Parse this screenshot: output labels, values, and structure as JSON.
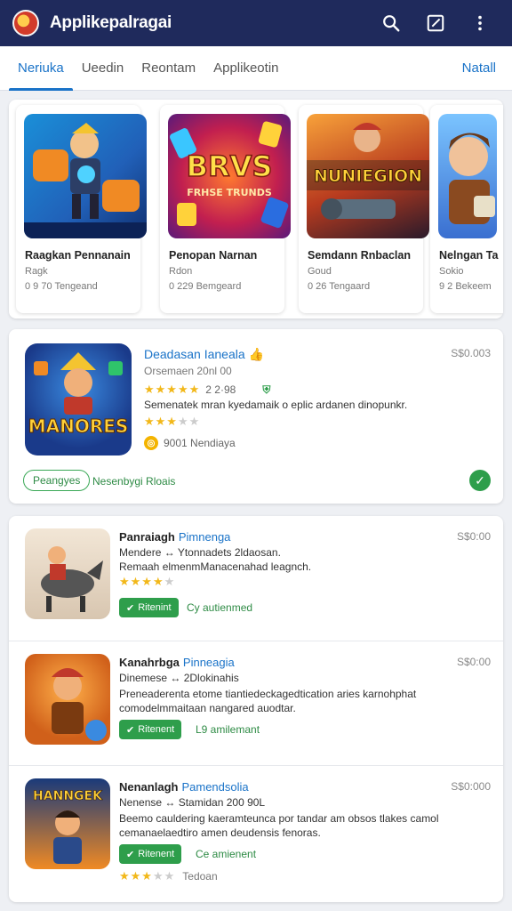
{
  "appbar": {
    "title": "Applikepalragai",
    "icons": [
      "search-icon",
      "edit-icon",
      "more-vert-icon"
    ]
  },
  "tabs": {
    "items": [
      "Neriuka",
      "Ueedin",
      "Reontam",
      "Applikeotin"
    ],
    "active_index": 0,
    "right_link": "Natall"
  },
  "featured": [
    {
      "name": "Raagkan Pennanain",
      "sub": "Ragk",
      "meta": "0 9 70 Tengeand",
      "art": "art-robot"
    },
    {
      "name": "Penopan Narnan",
      "sub": "Rdon",
      "meta": "0 229 Bemgeard",
      "art": "art-brvs"
    },
    {
      "name": "Semdann Rnbaclan",
      "sub": "Goud",
      "meta": "0 26 Tengaard",
      "art": "art-nunie"
    },
    {
      "name": "Nelngan Ta",
      "sub": "Sokio",
      "meta": "9 2 Bekeem",
      "art": "art-hero"
    }
  ],
  "featured_art_text": {
    "brvs_title": "BRVS",
    "brvs_sub": "FRHSE TRUNDS",
    "nunie_title": "NUNIEGION"
  },
  "hero": {
    "title": "Deadasan Ianeala",
    "sub": "Orsemaen 20nl 00",
    "rating_text": "2 2·98",
    "desc": "Semenatek mran kyedamaik o eplic ardanen dinopunkr.",
    "stars": 3,
    "coin_label": "9001 Nendiaya",
    "chip": "Peangyes",
    "chip_text": "Nesenbygi Rloais",
    "price": "S$0.003",
    "art_text": "MANORES"
  },
  "list": [
    {
      "title": "Panraiagh",
      "dev": "Pimnenga",
      "price": "S$0:00",
      "line1": "Mendere ↔ Ytonnadets 2ldaosan.",
      "line2": "Remaah elmenmManacenahad leagnch.",
      "line3": "",
      "stars": 4,
      "button": "Ritenint",
      "button_text": "Cy autienmed",
      "rating_text": ""
    },
    {
      "title": "Kanahrbga",
      "dev": "Pinneagia",
      "price": "S$0:00",
      "line1": "Dinemese ↔ 2Dlokinahis",
      "line2": "Preneaderenta etome tiantiedeckagedtication aries karnohphat",
      "line3": "comodelmmaitaan nangared auodtar.",
      "stars": 0,
      "button": "Ritenent",
      "button_text": "L9 amilemant",
      "rating_text": ""
    },
    {
      "title": "Nenanlagh",
      "dev": "Pamendsolia",
      "price": "S$0:000",
      "line1": "Nenense ↔ Stamidan 200 90L",
      "line2": "Beemo cauldering kaeramteunca por tandar am obsos tlakes camol",
      "line3": "cemanaelaedtiro amen deudensis fenoras.",
      "stars": 3,
      "button": "Ritenent",
      "button_text": "Ce amienent",
      "rating_text": "Tedoan"
    }
  ],
  "row_art_text": {
    "row3": "HANNGEK"
  },
  "colors": {
    "appbar": "#1f2a5c",
    "accent": "#1a73c8",
    "green": "#2e9e4b",
    "star": "#f2b81a"
  }
}
